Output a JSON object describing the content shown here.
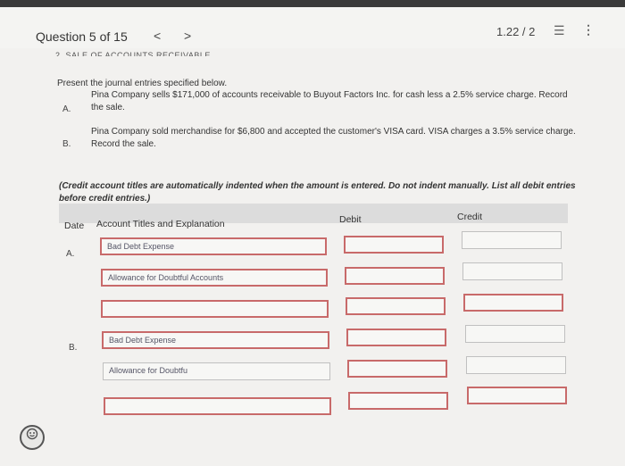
{
  "header": {
    "question_label": "Question 5 of 15",
    "prev": "<",
    "next": ">",
    "score": "1.22 / 2",
    "list_icon": "☰",
    "menu_icon": "⋮"
  },
  "section_title": "2. SALE OF ACCOUNTS RECEIVABLE",
  "instructions": "Present the journal entries specified below.",
  "problems": [
    {
      "letter": "A.",
      "line1": "Pina Company sells $171,000 of accounts receivable to Buyout Factors Inc. for cash less a 2.5% service charge. Record",
      "line2": "the sale."
    },
    {
      "letter": "B.",
      "line1": "Pina Company sold merchandise for $6,800 and accepted the customer's VISA card. VISA charges a 3.5% service charge.",
      "line2": "Record the sale."
    }
  ],
  "note": "(Credit account titles are automatically indented when the amount is entered. Do not indent manually. List all debit entries before credit entries.)",
  "table_header": {
    "date": "Date",
    "account": "Account Titles and Explanation",
    "debit": "Debit",
    "credit": "Credit"
  },
  "entries": {
    "a_letter": "A.",
    "b_letter": "B.",
    "a1": "Bad Debt Expense",
    "a2": "Allowance for Doubtful Accounts",
    "a3": "",
    "b1": "Bad Debt Expense",
    "b2": "Allowance for Doubtfu",
    "b3": ""
  },
  "help_icon": "help-icon"
}
